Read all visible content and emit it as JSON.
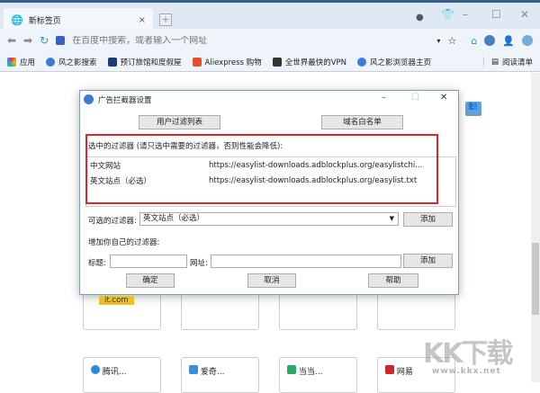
{
  "browser": {
    "tab_title": "新标签页",
    "tab_close": "×",
    "new_tab": "+",
    "address_placeholder": "在百度中搜索，或者输入一个网址",
    "bookmarks": [
      {
        "label": "应用",
        "color": "#e34"
      },
      {
        "label": "风之影搜索",
        "color": "#3a7bd5"
      },
      {
        "label": "预订旅馆和度假屋",
        "color": "#1a3c7a"
      },
      {
        "label": "Aliexpress 购物",
        "color": "#e8502a"
      },
      {
        "label": "全世界最快的VPN",
        "color": "#333"
      },
      {
        "label": "风之影浏览器主页",
        "color": "#3a7bd5"
      }
    ],
    "reading_list": "阅读清单"
  },
  "dialog": {
    "title": "广告拦截器设置",
    "user_filter_btn": "用户过滤列表",
    "whitelist_btn": "域名白名单",
    "selected_label": "选中的过滤器 (请只选中需要的过滤器，否则性能会降低):",
    "filters": [
      {
        "name": "中文网站",
        "url": "https://easylist-downloads.adblockplus.org/easylistchi..."
      },
      {
        "name": "英文站点（必选）",
        "url": "https://easylist-downloads.adblockplus.org/easylist.txt"
      }
    ],
    "optional_label": "可选的过滤器:",
    "optional_value": "英文站点（必选）",
    "add_btn": "添加",
    "custom_label": "增加你自己的过滤器:",
    "title_label": "标题:",
    "url_label": "网址:",
    "add_btn2": "添加",
    "ok": "确定",
    "cancel": "取消",
    "help": "帮助"
  },
  "tiles": [
    {
      "label": "腾讯...",
      "color": "#2a8ae0"
    },
    {
      "label": "爱奇...",
      "color": "#3a8dd8"
    },
    {
      "label": "当当...",
      "color": "#2aa86a"
    },
    {
      "label": "网易",
      "color": "#d0242a"
    }
  ],
  "tile_logo": "it.com",
  "watermark": {
    "text": "KK下载",
    "url": "www.kkx.net"
  }
}
